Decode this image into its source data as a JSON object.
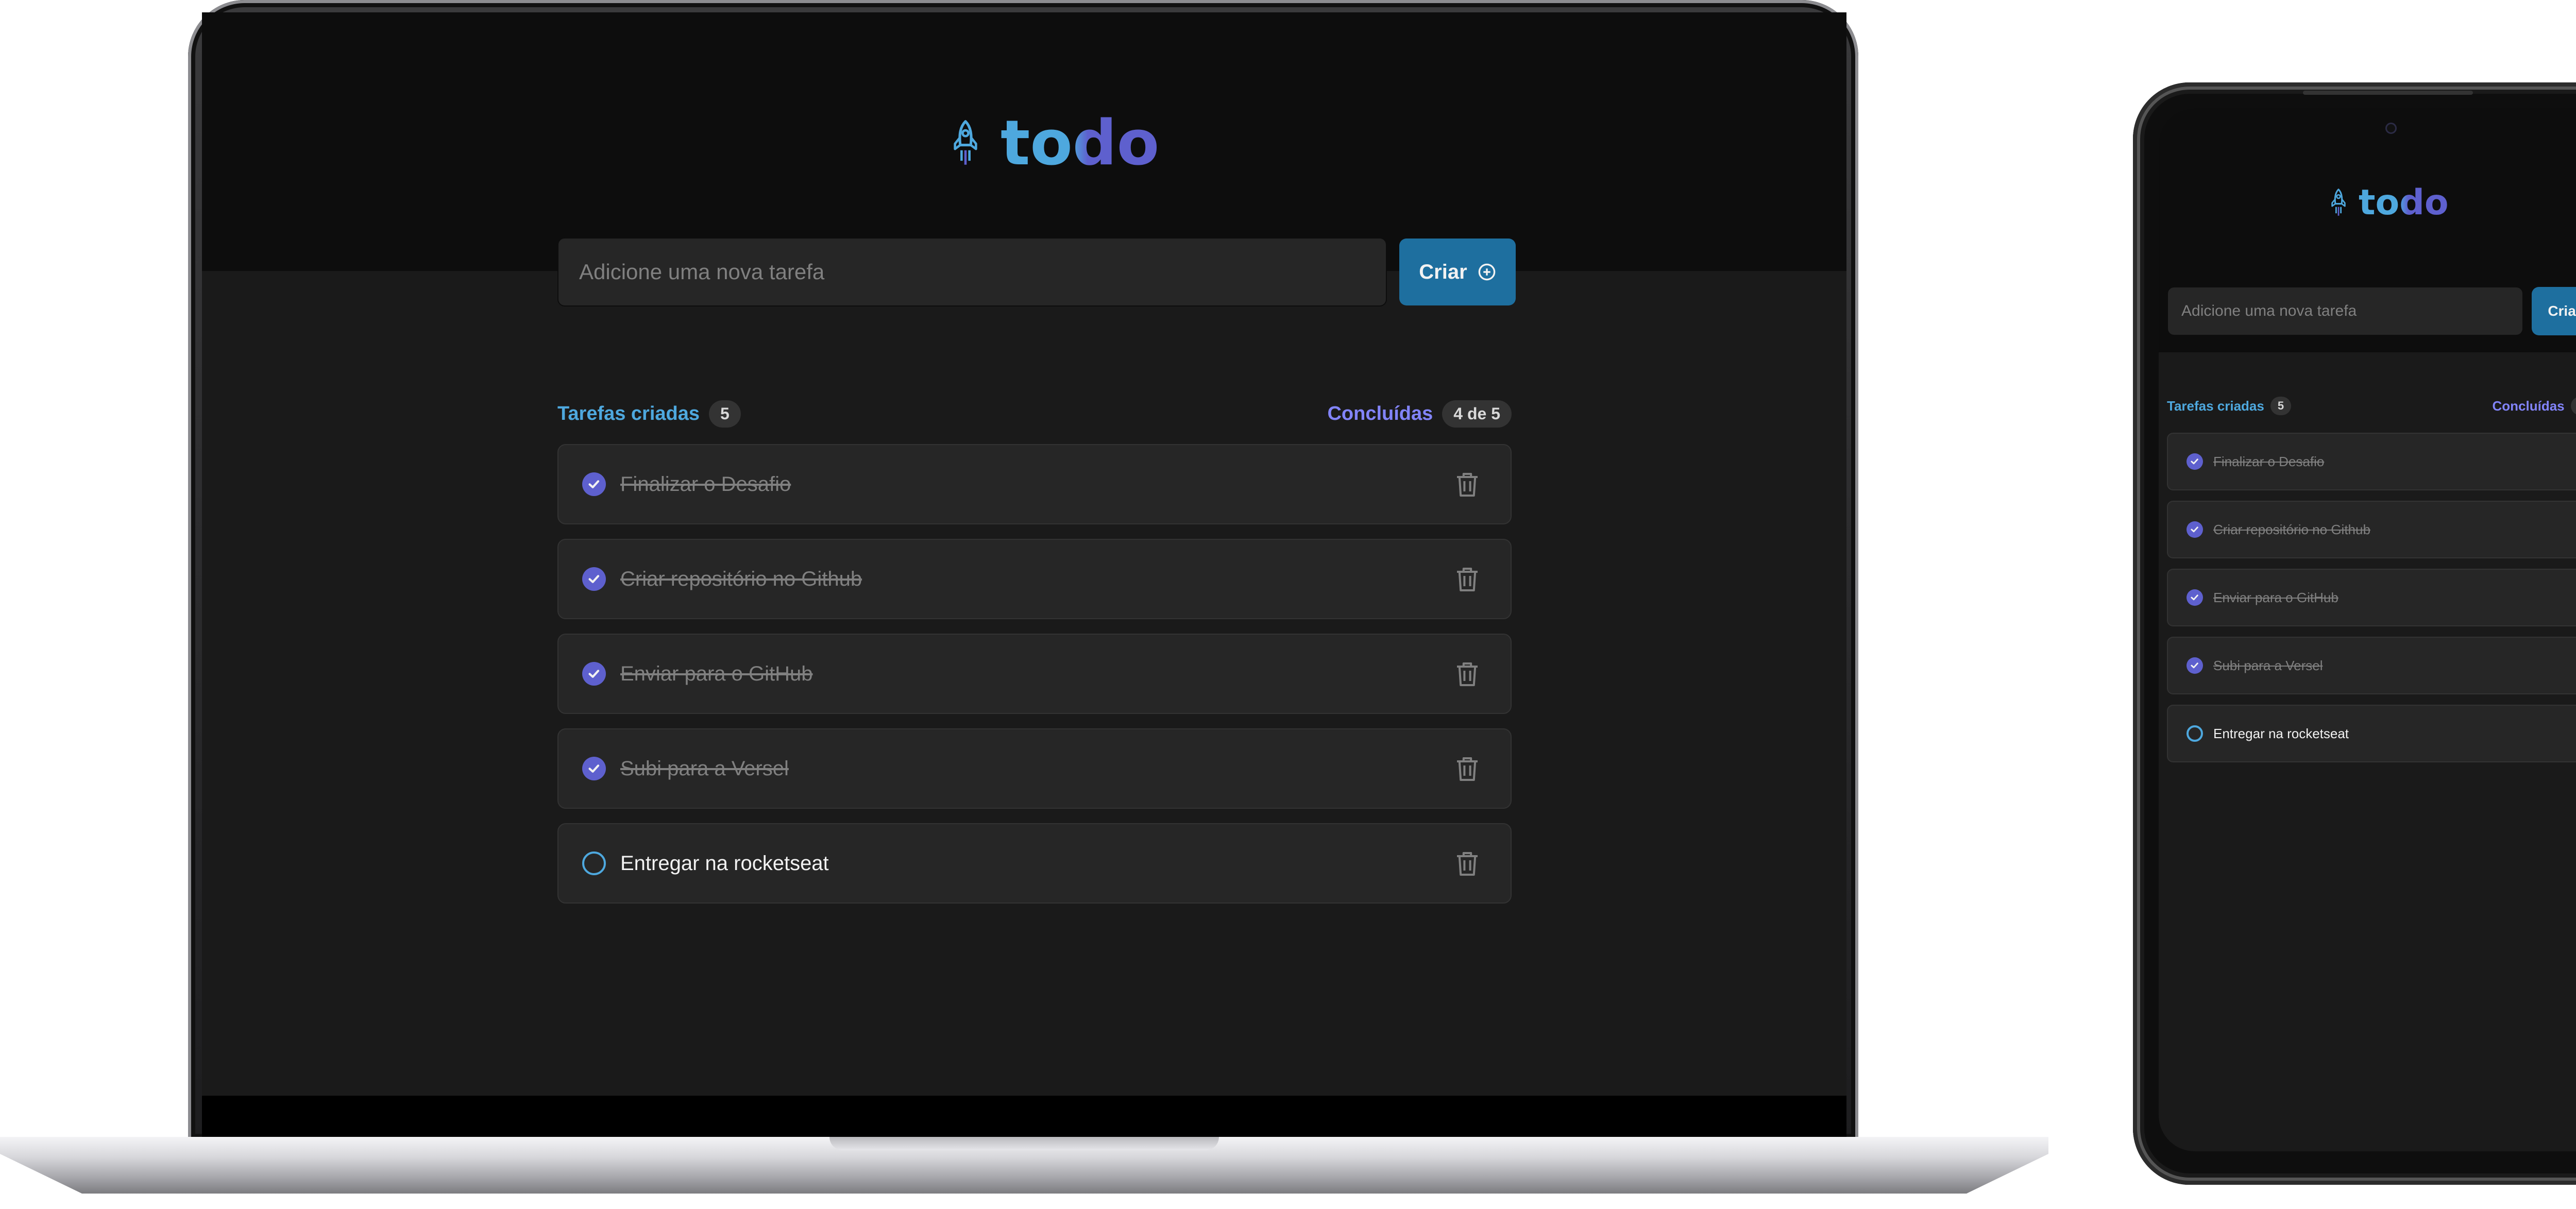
{
  "app": {
    "logo_text": "todo",
    "input_placeholder": "Adicione uma nova tarefa",
    "create_button_label": "Criar",
    "created_label": "Tarefas criadas",
    "created_count": "5",
    "completed_label": "Concluídas",
    "completed_count": "4 de 5",
    "tasks": [
      {
        "text": "Finalizar o Desafio",
        "done": true
      },
      {
        "text": "Criar repositório no Github",
        "done": true
      },
      {
        "text": "Enviar para o GitHub",
        "done": true
      },
      {
        "text": "Subi para a Versel",
        "done": true
      },
      {
        "text": "Entregar na rocketseat",
        "done": false
      }
    ]
  },
  "colors": {
    "brand_blue": "#4ea8de",
    "brand_purple": "#5e60ce",
    "button_blue": "#1e6f9f",
    "background": "#1a1a1a",
    "header": "#0d0d0d"
  },
  "icons": [
    "rocket-logo-icon",
    "plus-circle-icon",
    "check-icon",
    "trash-icon"
  ]
}
